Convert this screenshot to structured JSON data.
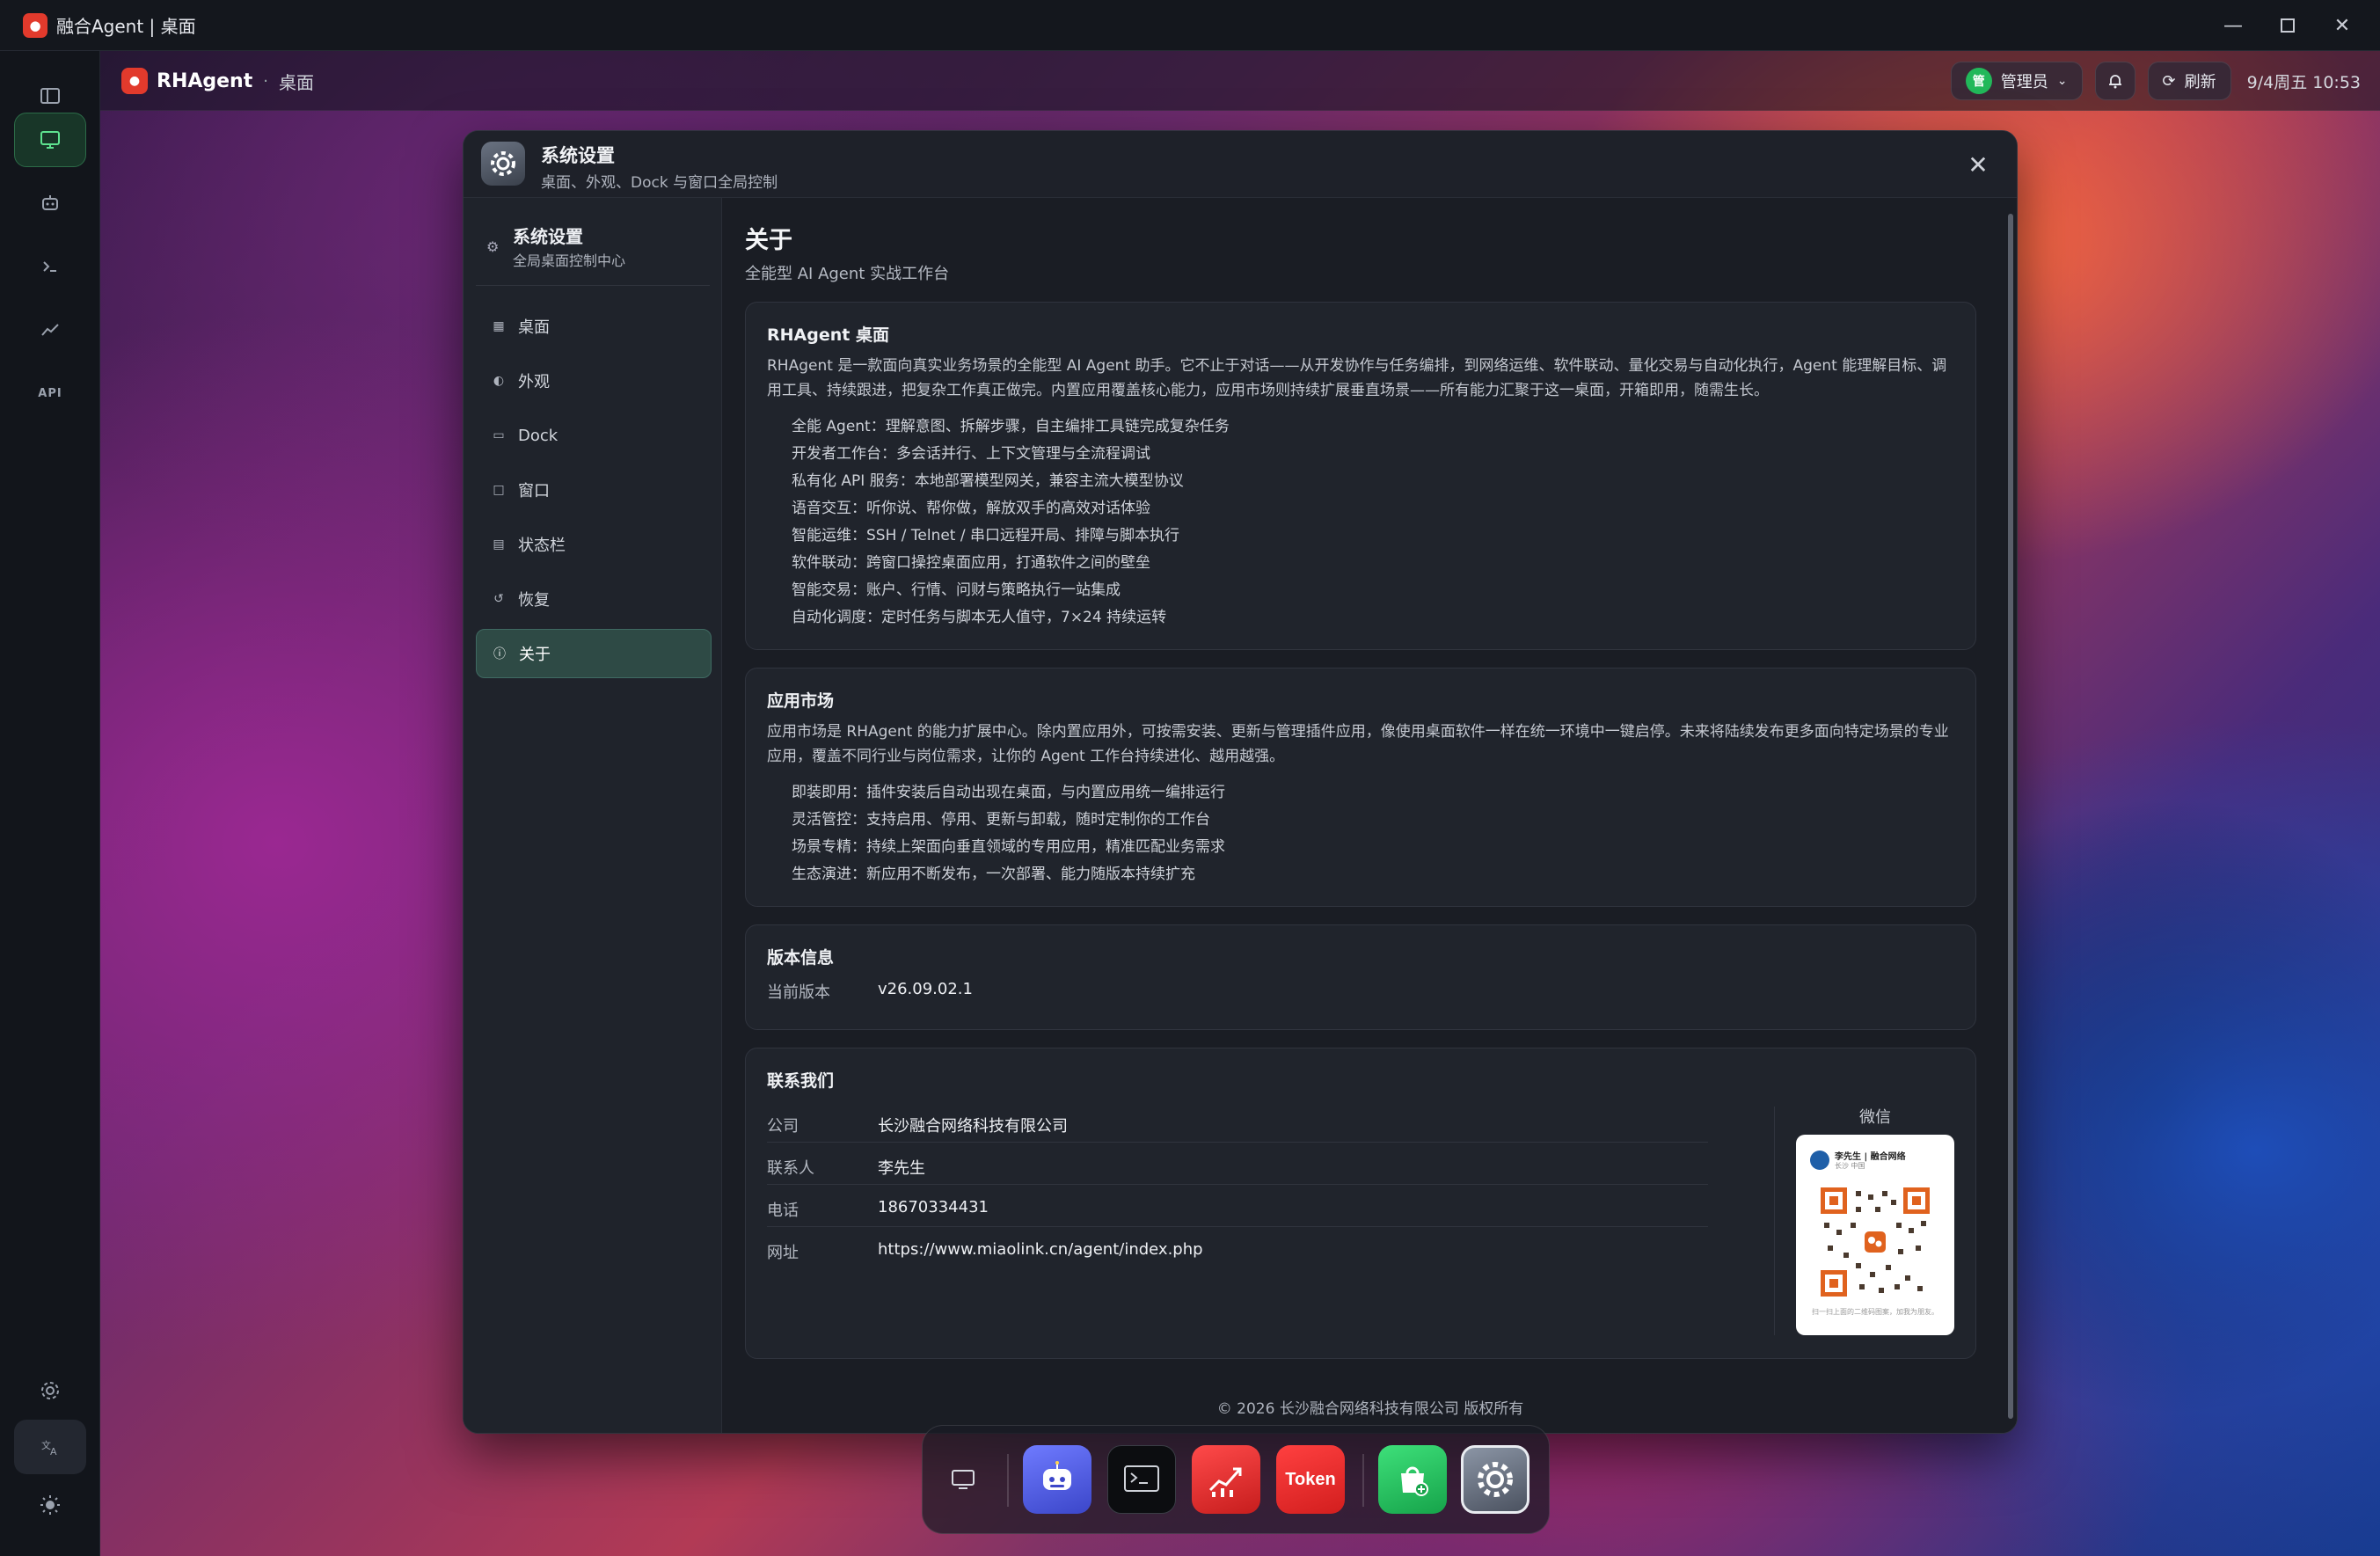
{
  "os": {
    "title": "融合Agent | 桌面"
  },
  "appbar": {
    "brand": "RHAgent",
    "separator": "·",
    "crumb": "桌面",
    "user_initial": "管",
    "user_label": "管理员",
    "refresh_label": "刷新",
    "datetime": "9/4周五 10:53"
  },
  "window": {
    "title": "系统设置",
    "subtitle": "桌面、外观、Dock 与窗口全局控制"
  },
  "sidebar": {
    "title": "系统设置",
    "subtitle": "全局桌面控制中心",
    "items": [
      {
        "label": "桌面",
        "icon": "grid-icon"
      },
      {
        "label": "外观",
        "icon": "palette-icon"
      },
      {
        "label": "Dock",
        "icon": "dock-icon"
      },
      {
        "label": "窗口",
        "icon": "window-icon"
      },
      {
        "label": "状态栏",
        "icon": "statusbar-icon"
      },
      {
        "label": "恢复",
        "icon": "restore-icon"
      },
      {
        "label": "关于",
        "icon": "info-icon",
        "active": true
      }
    ]
  },
  "about": {
    "title": "关于",
    "subtitle": "全能型 AI Agent 实战工作台",
    "intro": {
      "title": "RHAgent 桌面",
      "desc": "RHAgent 是一款面向真实业务场景的全能型 AI Agent 助手。它不止于对话——从开发协作与任务编排，到网络运维、软件联动、量化交易与自动化执行，Agent 能理解目标、调用工具、持续跟进，把复杂工作真正做完。内置应用覆盖核心能力，应用市场则持续扩展垂直场景——所有能力汇聚于这一桌面，开箱即用，随需生长。",
      "features": [
        "全能 Agent：理解意图、拆解步骤，自主编排工具链完成复杂任务",
        "开发者工作台：多会话并行、上下文管理与全流程调试",
        "私有化 API 服务：本地部署模型网关，兼容主流大模型协议",
        "语音交互：听你说、帮你做，解放双手的高效对话体验",
        "智能运维：SSH / Telnet / 串口远程开局、排障与脚本执行",
        "软件联动：跨窗口操控桌面应用，打通软件之间的壁垒",
        "智能交易：账户、行情、问财与策略执行一站集成",
        "自动化调度：定时任务与脚本无人值守，7×24 持续运转"
      ]
    },
    "market": {
      "title": "应用市场",
      "desc": "应用市场是 RHAgent 的能力扩展中心。除内置应用外，可按需安装、更新与管理插件应用，像使用桌面软件一样在统一环境中一键启停。未来将陆续发布更多面向特定场景的专业应用，覆盖不同行业与岗位需求，让你的 Agent 工作台持续进化、越用越强。",
      "features": [
        "即装即用：插件安装后自动出现在桌面，与内置应用统一编排运行",
        "灵活管控：支持启用、停用、更新与卸载，随时定制你的工作台",
        "场景专精：持续上架面向垂直领域的专用应用，精准匹配业务需求",
        "生态演进：新应用不断发布，一次部署、能力随版本持续扩充"
      ]
    },
    "version": {
      "title": "版本信息",
      "label": "当前版本",
      "value": "v26.09.02.1"
    },
    "contact": {
      "title": "联系我们",
      "rows": [
        {
          "k": "公司",
          "v": "长沙融合网络科技有限公司"
        },
        {
          "k": "联系人",
          "v": "李先生"
        },
        {
          "k": "电话",
          "v": "18670334431"
        },
        {
          "k": "网址",
          "v": "https://www.miaolink.cn/agent/index.php"
        }
      ],
      "qr_label": "微信",
      "qr_name": "李先生 | 融合网络",
      "qr_sub": "长沙 中国",
      "qr_hint": "扫一扫上面的二维码图案，加我为朋友。"
    },
    "footer": "© 2026 长沙融合网络科技有限公司 版权所有"
  },
  "dock": {
    "token_label": "Token",
    "items": [
      "desktop-icon",
      "agent-chat-icon",
      "terminal-icon",
      "trading-chart-icon",
      "token-icon",
      "app-store-icon",
      "settings-icon"
    ]
  },
  "colors": {
    "accent_green": "#22b85a",
    "active_nav": "#2e4a45",
    "brand_red": "#e23a2c"
  }
}
